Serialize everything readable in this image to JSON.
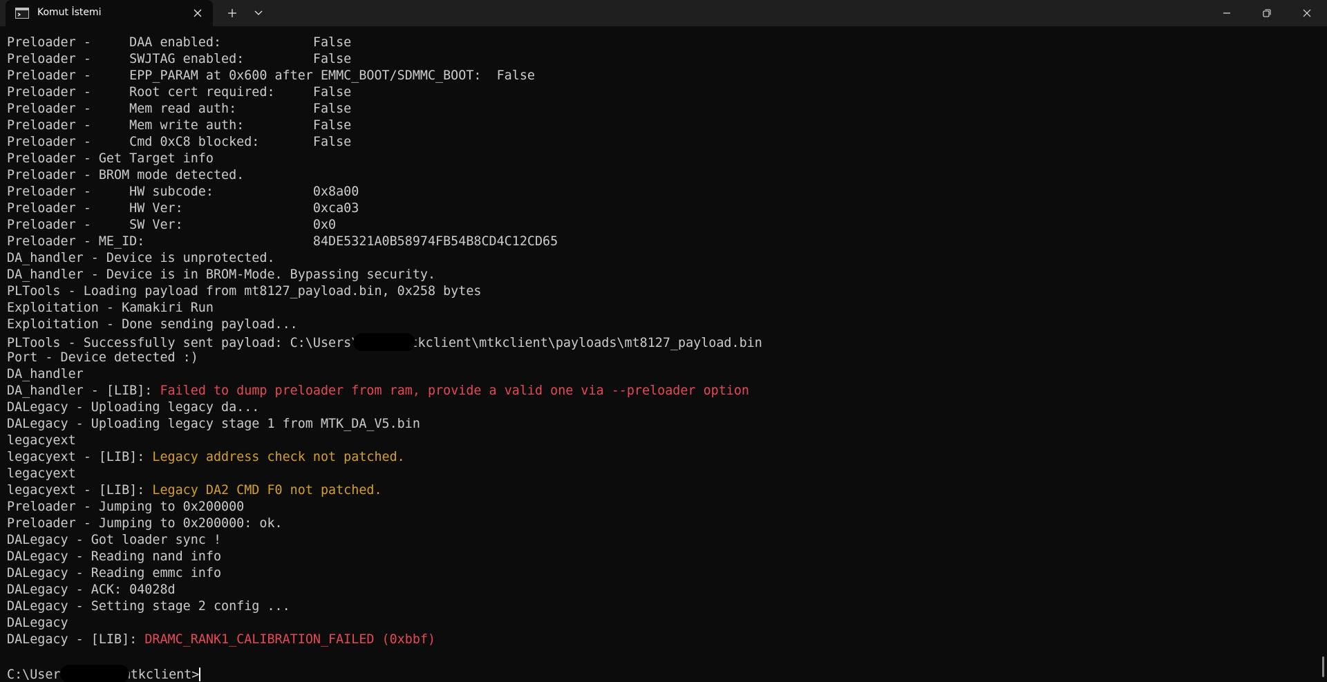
{
  "window": {
    "tab_title": "Komut İstemi",
    "icons": {
      "tab": "terminal-icon",
      "close_tab": "close-icon",
      "new_tab": "plus-icon",
      "dropdown": "chevron-down-icon",
      "minimize": "minimize-icon",
      "maximize": "restore-icon",
      "close": "close-icon"
    }
  },
  "colors": {
    "background": "#0c0c0c",
    "text": "#cccccc",
    "error": "#e74856",
    "warning": "#d4a02a"
  },
  "terminal": {
    "lines": [
      {
        "text": "Preloader -     DAA enabled:            False"
      },
      {
        "text": "Preloader -     SWJTAG enabled:         False"
      },
      {
        "text": "Preloader -     EPP_PARAM at 0x600 after EMMC_BOOT/SDMMC_BOOT:  False"
      },
      {
        "text": "Preloader -     Root cert required:     False"
      },
      {
        "text": "Preloader -     Mem read auth:          False"
      },
      {
        "text": "Preloader -     Mem write auth:         False"
      },
      {
        "text": "Preloader -     Cmd 0xC8 blocked:       False"
      },
      {
        "text": "Preloader - Get Target info"
      },
      {
        "text": "Preloader - BROM mode detected."
      },
      {
        "text": "Preloader -     HW subcode:             0x8a00"
      },
      {
        "text": "Preloader -     HW Ver:                 0xca03"
      },
      {
        "text": "Preloader -     SW Ver:                 0x0"
      },
      {
        "text": "Preloader - ME_ID:                      84DE5321A0B58974FB54B8CD4C12CD65"
      },
      {
        "text": "DA_handler - Device is unprotected."
      },
      {
        "text": "DA_handler - Device is in BROM-Mode. Bypassing security."
      },
      {
        "text": "PLTools - Loading payload from mt8127_payload.bin, 0x258 bytes"
      },
      {
        "text": "Exploitation - Kamakiri Run"
      },
      {
        "text": "Exploitation - Done sending payload..."
      },
      {
        "text": "PLTools - Successfully sent payload: C:\\Users\\",
        "redacted": true,
        "suffix": "\\mtkclient\\mtkclient\\payloads\\mt8127_payload.bin"
      },
      {
        "text": "Port - Device detected :)"
      },
      {
        "text": "DA_handler"
      },
      {
        "text": "DA_handler - [LIB]: ",
        "highlight": "Failed to dump preloader from ram, provide a valid one via --preloader option",
        "level": "error"
      },
      {
        "text": "DALegacy - Uploading legacy da..."
      },
      {
        "text": "DALegacy - Uploading legacy stage 1 from MTK_DA_V5.bin"
      },
      {
        "text": "legacyext"
      },
      {
        "text": "legacyext - [LIB]: ",
        "highlight": "Legacy address check not patched.",
        "level": "warning"
      },
      {
        "text": "legacyext"
      },
      {
        "text": "legacyext - [LIB]: ",
        "highlight": "Legacy DA2 CMD F0 not patched.",
        "level": "warning"
      },
      {
        "text": "Preloader - Jumping to 0x200000"
      },
      {
        "text": "Preloader - Jumping to 0x200000: ok."
      },
      {
        "text": "DALegacy - Got loader sync !"
      },
      {
        "text": "DALegacy - Reading nand info"
      },
      {
        "text": "DALegacy - Reading emmc info"
      },
      {
        "text": "DALegacy - ACK: 04028d"
      },
      {
        "text": "DALegacy - Setting stage 2 config ..."
      },
      {
        "text": "DALegacy"
      },
      {
        "text": "DALegacy - [LIB]: ",
        "highlight": "DRAMC_RANK1_CALIBRATION_FAILED (0xbbf)",
        "level": "error"
      }
    ],
    "prompt": {
      "prefix": "C:\\Users",
      "suffix": "\\mtkclient>"
    }
  }
}
